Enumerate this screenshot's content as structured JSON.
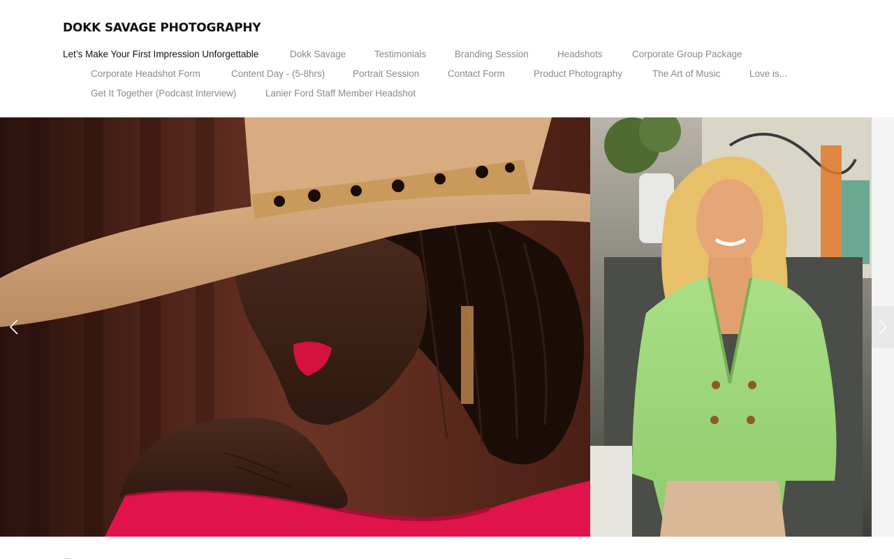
{
  "site": {
    "title": "DOKK SAVAGE PHOTOGRAPHY"
  },
  "nav": {
    "items": [
      {
        "label": "Let’s Make Your First Impression Unforgettable",
        "active": true
      },
      {
        "label": "Dokk Savage"
      },
      {
        "label": "Testimonials"
      },
      {
        "label": "Branding Session"
      },
      {
        "label": "Headshots"
      },
      {
        "label": "Corporate Group Package"
      },
      {
        "label": "Corporate Headshot Form"
      },
      {
        "label": "Content Day - (5-8hrs)"
      },
      {
        "label": "Portrait Session"
      },
      {
        "label": "Contact Form"
      },
      {
        "label": "Product Photography"
      },
      {
        "label": "The Art of Music"
      },
      {
        "label": "Love is..."
      },
      {
        "label": "Get It Together (Podcast Interview)"
      },
      {
        "label": "Lanier Ford Staff Member Headshot"
      }
    ]
  },
  "gallery": {
    "slides": [
      {
        "subject": "portrait-woman-tan-hat-pink-sweater"
      },
      {
        "subject": "portrait-woman-green-blazer"
      },
      {
        "subject": "next-slide-peek"
      }
    ],
    "prev_icon": "chevron-left-icon",
    "next_icon": "chevron-right-icon"
  },
  "colors": {
    "text_active": "#111111",
    "text_nav": "#8a8a8a",
    "background": "#ffffff"
  }
}
